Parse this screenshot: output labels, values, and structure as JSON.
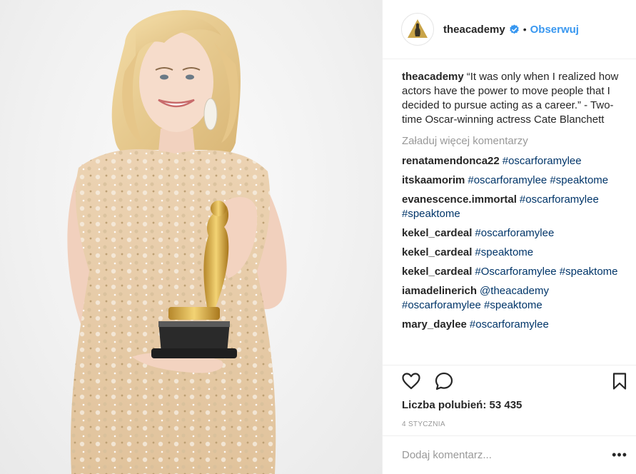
{
  "post": {
    "image_description_icon": "portrait-photo",
    "author": "theacademy",
    "follow_label": "Obserwuj",
    "separator": "•",
    "caption_user": "theacademy",
    "caption_text": "“It was only when I realized how actors have the power to move people that I decided to pursue acting as a career.” - Two-time Oscar-winning actress Cate Blanchett",
    "load_more": "Załaduj więcej komentarzy",
    "comments": [
      {
        "user": "renatamendonca22",
        "text": "#oscarforamylee"
      },
      {
        "user": "itskaamorim",
        "text": "#oscarforamylee #speaktome"
      },
      {
        "user": "evanescence.immortal",
        "text": "#oscarforamylee #speaktome"
      },
      {
        "user": "kekel_cardeal",
        "text": "#oscarforamylee"
      },
      {
        "user": "kekel_cardeal",
        "text": "#speaktome"
      },
      {
        "user": "kekel_cardeal",
        "text": "#Oscarforamylee #speaktome"
      },
      {
        "user": "iamadelinerich",
        "text": "@theacademy #oscarforamylee #speaktome"
      },
      {
        "user": "mary_daylee",
        "text": "#oscarforamylee"
      }
    ],
    "likes": "Liczba polubień: 53 435",
    "date": "4 stycznia",
    "add_comment_placeholder": "Dodaj komentarz...",
    "more_label": "•••",
    "colors": {
      "link_blue": "#3897f0",
      "hashtag": "#003569",
      "muted": "#999999",
      "text": "#262626",
      "verified": "#3897f0",
      "gold": "#c9a449"
    },
    "icons": [
      "heart-icon",
      "comment-icon",
      "bookmark-icon",
      "verified-icon",
      "oscar-logo-icon"
    ]
  }
}
